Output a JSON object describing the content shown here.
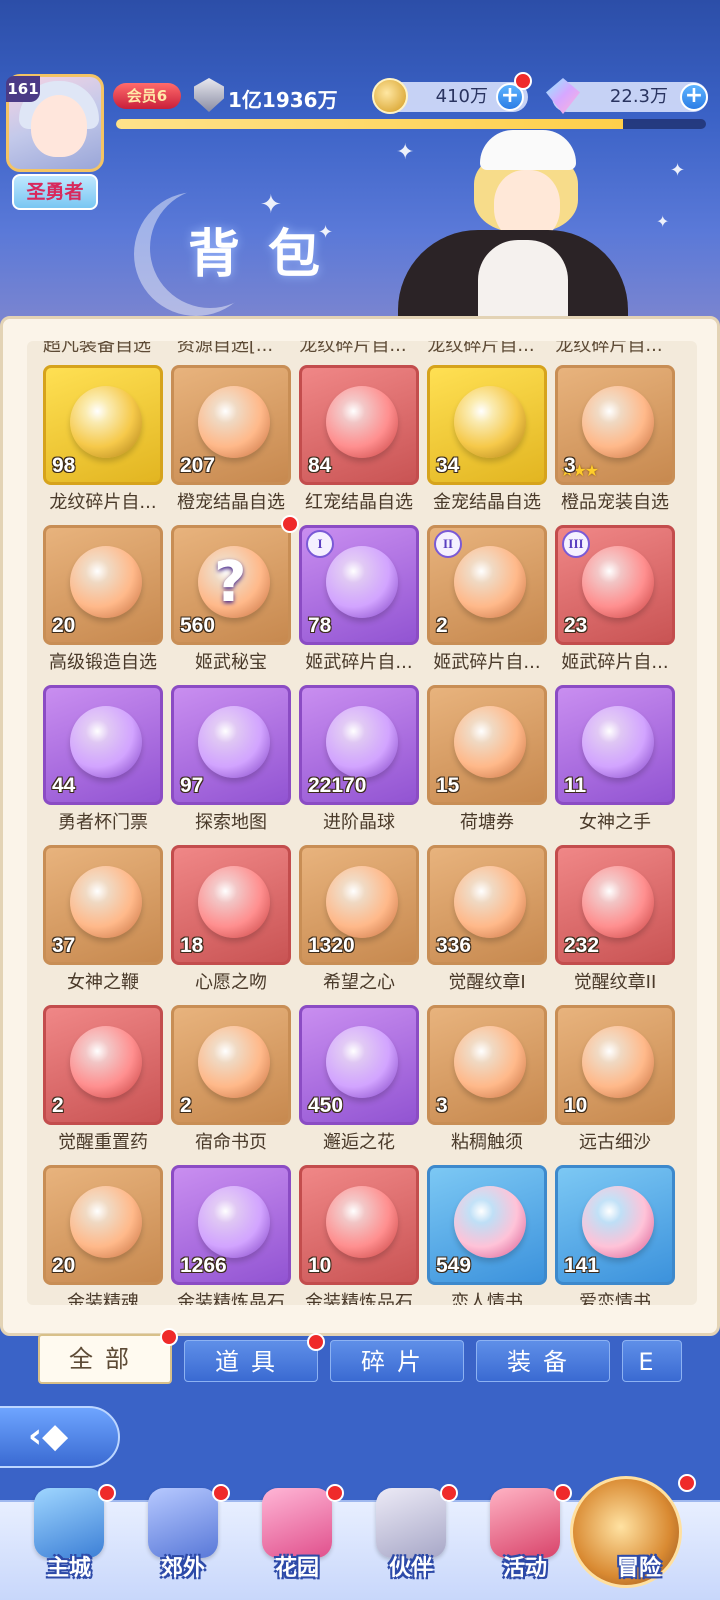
{
  "header": {
    "level": "161",
    "rank_title": "圣勇者",
    "vip": "会员6",
    "power": "1亿1936万",
    "gold": "410万",
    "gems": "22.3万",
    "page_title": "背包",
    "exp_progress_percent": 86
  },
  "colors": {
    "accent_blue": "#3b62c6",
    "panel_bg": "#fbf4e9",
    "red_dot": "#ef2a2a"
  },
  "cutoff_row": [
    "超凡装备自选",
    "资源自选[...",
    "龙纹碎片自...",
    "龙纹碎片自...",
    "龙纹碎片自..."
  ],
  "items": [
    {
      "name": "龙纹碎片自...",
      "count": "98",
      "rarity": "gold"
    },
    {
      "name": "橙宠结晶自选",
      "count": "207",
      "rarity": "orange"
    },
    {
      "name": "红宠结晶自选",
      "count": "84",
      "rarity": "red"
    },
    {
      "name": "金宠结晶自选",
      "count": "34",
      "rarity": "gold"
    },
    {
      "name": "橙品宠装自选",
      "count": "3",
      "rarity": "orange",
      "stars": "★★★"
    },
    {
      "name": "高级锻造自选",
      "count": "20",
      "rarity": "orange"
    },
    {
      "name": "姬武秘宝",
      "count": "560",
      "rarity": "orange",
      "dot": true,
      "mark": "?"
    },
    {
      "name": "姬武碎片自...",
      "count": "78",
      "rarity": "purple",
      "roman": "I"
    },
    {
      "name": "姬武碎片自...",
      "count": "2",
      "rarity": "orange",
      "roman": "II"
    },
    {
      "name": "姬武碎片自...",
      "count": "23",
      "rarity": "red",
      "roman": "III"
    },
    {
      "name": "勇者杯门票",
      "count": "44",
      "rarity": "purple"
    },
    {
      "name": "探索地图",
      "count": "97",
      "rarity": "purple"
    },
    {
      "name": "进阶晶球",
      "count": "22170",
      "rarity": "purple"
    },
    {
      "name": "荷塘券",
      "count": "15",
      "rarity": "orange"
    },
    {
      "name": "女神之手",
      "count": "11",
      "rarity": "purple"
    },
    {
      "name": "女神之鞭",
      "count": "37",
      "rarity": "orange"
    },
    {
      "name": "心愿之吻",
      "count": "18",
      "rarity": "red"
    },
    {
      "name": "希望之心",
      "count": "1320",
      "rarity": "orange"
    },
    {
      "name": "觉醒纹章I",
      "count": "336",
      "rarity": "orange"
    },
    {
      "name": "觉醒纹章II",
      "count": "232",
      "rarity": "red"
    },
    {
      "name": "觉醒重置药",
      "count": "2",
      "rarity": "red"
    },
    {
      "name": "宿命书页",
      "count": "2",
      "rarity": "orange"
    },
    {
      "name": "邂逅之花",
      "count": "450",
      "rarity": "purple"
    },
    {
      "name": "粘稠触须",
      "count": "3",
      "rarity": "orange"
    },
    {
      "name": "远古细沙",
      "count": "10",
      "rarity": "orange"
    },
    {
      "name": "金装精魂",
      "count": "20",
      "rarity": "orange"
    },
    {
      "name": "金装精炼晶石",
      "count": "1266",
      "rarity": "purple"
    },
    {
      "name": "金装精炼品石",
      "count": "10",
      "rarity": "red"
    },
    {
      "name": "恋人情书",
      "count": "549",
      "rarity": "blue"
    },
    {
      "name": "爱恋情书",
      "count": "141",
      "rarity": "blue"
    }
  ],
  "tabs": [
    {
      "label": "全部",
      "active": true,
      "dot": true
    },
    {
      "label": "道具",
      "dot": true
    },
    {
      "label": "碎片"
    },
    {
      "label": "装备"
    },
    {
      "label": "E"
    }
  ],
  "nav": [
    {
      "label": "主城",
      "icon": "castle-icon"
    },
    {
      "label": "郊外",
      "icon": "gate-icon"
    },
    {
      "label": "花园",
      "icon": "heart-garden-icon"
    },
    {
      "label": "伙伴",
      "icon": "partner-icon"
    },
    {
      "label": "活动",
      "icon": "gift-icon"
    },
    {
      "label": "冒险",
      "icon": "compass-icon"
    }
  ]
}
